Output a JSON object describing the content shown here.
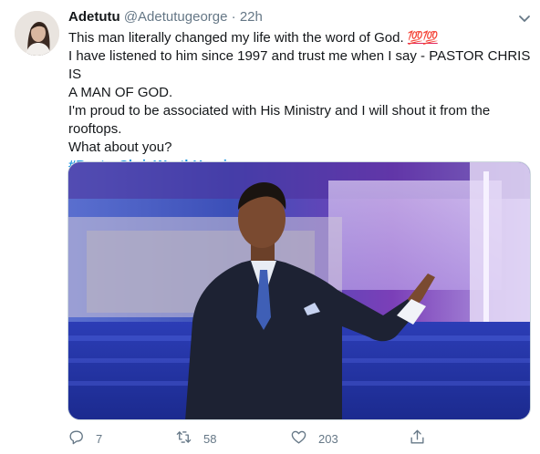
{
  "tweet": {
    "display_name": "Adetutu",
    "handle": "@Adetutugeorge",
    "separator": "·",
    "time": "22h",
    "lines": [
      "This man literally changed my life with the word of God.",
      "I have listened to him since 1997 and trust me when I say - PASTOR CHRIS IS",
      "A MAN OF GOD.",
      "I'm proud to be associated with His Ministry and I will shout it from the",
      "rooftops.",
      "What about you?"
    ],
    "emoji": "💯💯",
    "hashtag": "#PastorChrisWorthHearing"
  },
  "actions": {
    "reply_count": "7",
    "retweet_count": "58",
    "like_count": "203"
  },
  "icons": {
    "caret": "chevron-down-icon",
    "reply": "reply-icon",
    "retweet": "retweet-icon",
    "like": "heart-icon",
    "share": "share-icon"
  },
  "colors": {
    "accent": "#1b95e0",
    "secondary_text": "#657786",
    "primary_text": "#14171a"
  }
}
